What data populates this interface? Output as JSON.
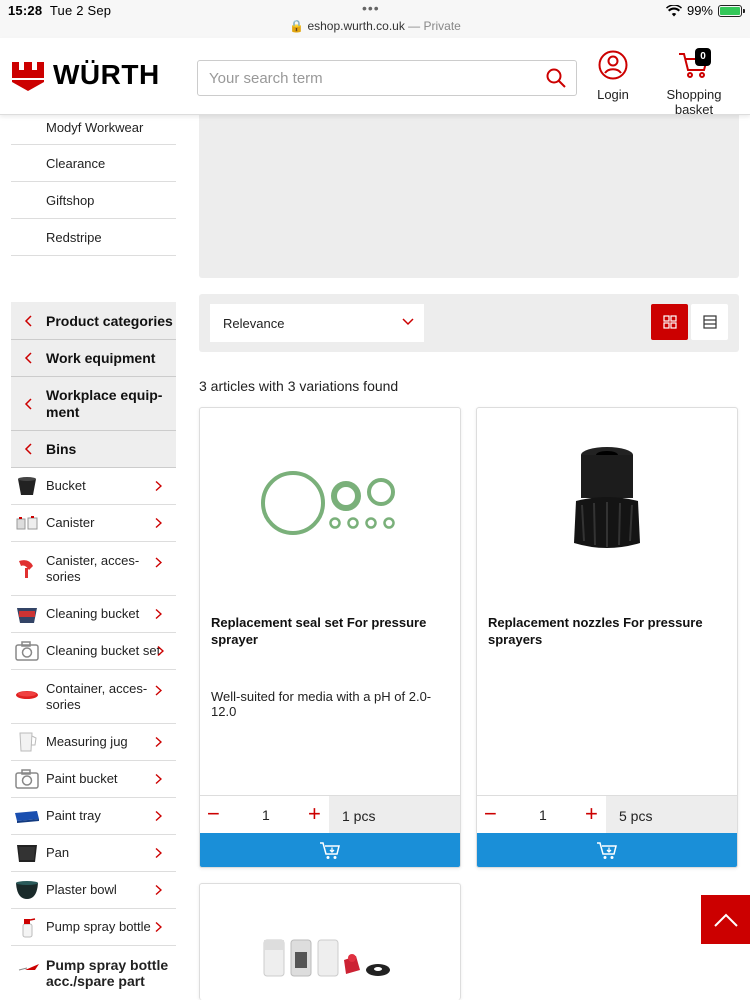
{
  "status": {
    "time": "15:28",
    "date": "Tue 2 Sep",
    "url": "eshop.wurth.co.uk",
    "url_suffix": "— Private",
    "battery": "99%"
  },
  "header": {
    "brand": "WÜRTH",
    "search_placeholder": "Your search term",
    "login_label": "Login",
    "basket_label": "Shopping basket",
    "basket_count": "0"
  },
  "sidebar": {
    "top_links": [
      "Modyf Workwear",
      "Clearance",
      "Giftshop",
      "Redstripe"
    ],
    "breadcrumbs": [
      "Product categories",
      "Work equipment",
      "Workplace equip-ment",
      "Bins"
    ],
    "subcategories": [
      "Bucket",
      "Canister",
      "Canister, acces-sories",
      "Cleaning bucket",
      "Cleaning bucket set",
      "Container, acces-sories",
      "Measuring jug",
      "Paint bucket",
      "Paint tray",
      "Pan",
      "Plaster bowl",
      "Pump spray bottle",
      "Pump spray bottle acc./spare part"
    ]
  },
  "toolbar": {
    "sort_value": "Relevance"
  },
  "results": {
    "count_text": "3 articles with 3 variations found"
  },
  "products": [
    {
      "title": "Replacement seal set For pressure sprayer",
      "description": "Well-suited for media with a pH of 2.0-12.0",
      "quantity": "1",
      "unit": "1 pcs"
    },
    {
      "title": "Replacement nozzles For pressure sprayers",
      "description": "",
      "quantity": "1",
      "unit": "5 pcs"
    }
  ],
  "colors": {
    "brand_red": "#cc0000",
    "cart_blue": "#1a8fd8",
    "panel_grey": "#ededed"
  }
}
